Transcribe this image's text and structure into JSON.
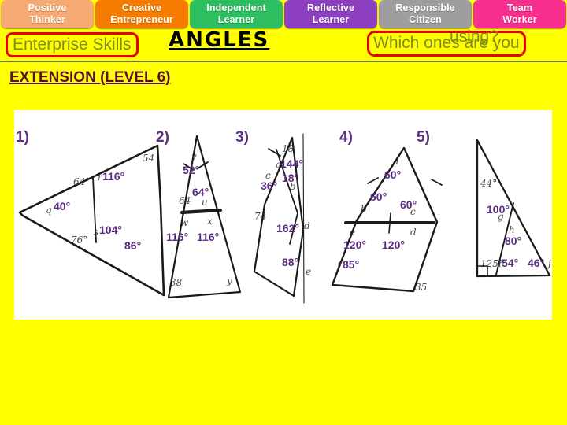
{
  "skills_bar": {
    "tabs": [
      {
        "line1": "Positive",
        "line2": "Thinker",
        "color": "#F5AA73",
        "name": "positive-thinker"
      },
      {
        "line1": "Creative",
        "line2": "Entrepreneur",
        "color": "#F57C00",
        "name": "creative-entrepreneur"
      },
      {
        "line1": "Independent",
        "line2": "Learner",
        "color": "#2DBE60",
        "name": "independent-learner"
      },
      {
        "line1": "Reflective",
        "line2": "Learner",
        "color": "#8C3FBF",
        "name": "reflective-learner"
      },
      {
        "line1": "Responsible",
        "line2": "Citizen",
        "color": "#9E9E9E",
        "name": "responsible-citizen"
      },
      {
        "line1": "Team",
        "line2": "Worker",
        "color": "#F72E8E",
        "name": "team-worker"
      }
    ]
  },
  "header": {
    "enterprise_skills": "Enterprise Skills",
    "title": "ANGLES",
    "which_ones": "Which ones are you",
    "using": "using?",
    "extension": "EXTENSION (LEVEL 6)",
    "box_border_color": "#E60000",
    "olive_text_color": "#7E8B1E",
    "extension_color": "#58102E",
    "background_color": "#FFFF00"
  },
  "worksheet": {
    "annotation_color": "#5B2D82",
    "questions": [
      {
        "number": "1)",
        "typed_answers": [
          "40°",
          "116°",
          "104°",
          "86°"
        ],
        "pencil_marks": [
          "q",
          "64°",
          "r",
          "54",
          "76°",
          "s"
        ]
      },
      {
        "number": "2)",
        "typed_answers": [
          "52°",
          "64°",
          "116°",
          "116°"
        ],
        "pencil_marks": [
          "v",
          "64",
          "u",
          "w",
          "x",
          "38",
          "y"
        ]
      },
      {
        "number": "3)",
        "typed_answers": [
          "144°",
          "18°",
          "36°",
          "162°",
          "88°"
        ],
        "pencil_marks": [
          "18",
          "a",
          "b",
          "c",
          "74",
          "d",
          "e"
        ]
      },
      {
        "number": "4)",
        "typed_answers": [
          "60°",
          "60°",
          "60°",
          "120°",
          "120°",
          "85°"
        ],
        "pencil_marks": [
          "a",
          "b",
          "c",
          "e",
          "d",
          "f",
          "35"
        ]
      },
      {
        "number": "5)",
        "typed_answers": [
          "100°",
          "80°",
          "54°",
          "46°"
        ],
        "pencil_marks": [
          "44°",
          "g",
          "h",
          "125°",
          "i",
          "j"
        ]
      }
    ]
  }
}
